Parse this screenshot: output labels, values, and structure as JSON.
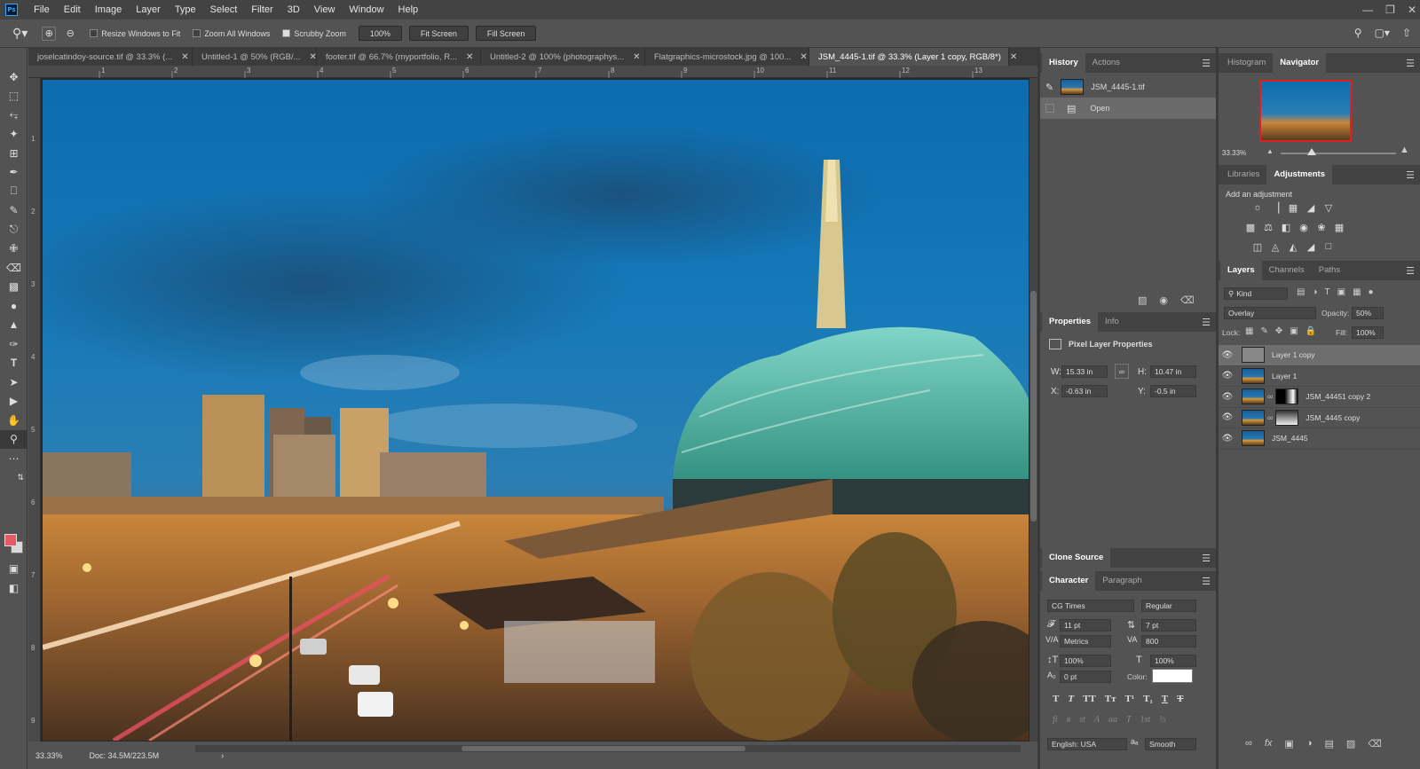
{
  "app": {
    "logo": "Ps"
  },
  "menu": [
    "File",
    "Edit",
    "Image",
    "Layer",
    "Type",
    "Select",
    "Filter",
    "3D",
    "View",
    "Window",
    "Help"
  ],
  "window_controls": {
    "minimize": "—",
    "restore": "❐",
    "close": "✕"
  },
  "options_bar": {
    "resize_windows": "Resize Windows to Fit",
    "zoom_all": "Zoom All Windows",
    "scrubby_zoom": "Scrubby Zoom",
    "zoom_value": "100%",
    "fit_screen": "Fit Screen",
    "fill_screen": "Fill Screen"
  },
  "doc_tabs": [
    "joselcatindoy-source.tif @ 33.3% (...",
    "Untitled-1 @ 50% (RGB/...",
    "footer.tif @ 66.7% (myportfolio, R...",
    "Untitled-2 @ 100% (photographys...",
    "Flatgraphics-microstock.jpg @ 100...",
    "JSM_4445-1.tif @ 33.3% (Layer 1 copy, RGB/8*)"
  ],
  "ruler_marks": [
    "1",
    "2",
    "3",
    "4",
    "5",
    "6",
    "7",
    "8",
    "9",
    "10",
    "11",
    "12",
    "13"
  ],
  "ruler_left_marks": [
    "1",
    "2",
    "3",
    "4",
    "5",
    "6",
    "7",
    "8",
    "9"
  ],
  "status": {
    "zoom": "33.33%",
    "doc": "Doc: 34.5M/223.5M"
  },
  "history": {
    "tabs": [
      "History",
      "Actions"
    ],
    "snapshot": "JSM_4445-1.tif",
    "step": "Open"
  },
  "navigator": {
    "tabs": [
      "Histogram",
      "Navigator"
    ],
    "zoom": "33.33%"
  },
  "adjustments": {
    "tabs": [
      "Libraries",
      "Adjustments"
    ],
    "title": "Add an adjustment"
  },
  "properties": {
    "tabs": [
      "Properties",
      "Info"
    ],
    "title": "Pixel Layer Properties",
    "w_label": "W:",
    "w": "15.33 in",
    "h_label": "H:",
    "h": "10.47 in",
    "x_label": "X:",
    "x": "-0.63 in",
    "y_label": "Y:",
    "y": "-0.5 in"
  },
  "clone_source": {
    "title": "Clone Source"
  },
  "character": {
    "tabs": [
      "Character",
      "Paragraph"
    ],
    "font": "CG Times",
    "style": "Regular",
    "size": "11 pt",
    "leading": "7 pt",
    "kerning": "Metrics",
    "tracking": "800",
    "vscale": "100%",
    "hscale": "100%",
    "baseline": "0 pt",
    "color_label": "Color:",
    "language": "English: USA",
    "antialias": "Smooth"
  },
  "layers": {
    "tabs": [
      "Layers",
      "Channels",
      "Paths"
    ],
    "kind": "Kind",
    "blend": "Overlay",
    "opacity_label": "Opacity:",
    "opacity": "50%",
    "lock_label": "Lock:",
    "fill_label": "Fill:",
    "fill": "100%",
    "items": [
      {
        "name": "Layer 1 copy",
        "thumb": "grey",
        "mask": "",
        "selected": true
      },
      {
        "name": "Layer 1",
        "thumb": "photo",
        "mask": "",
        "selected": false
      },
      {
        "name": "JSM_44451 copy 2",
        "thumb": "photo",
        "mask": "dark",
        "selected": false
      },
      {
        "name": "JSM_4445 copy",
        "thumb": "photo",
        "mask": "light",
        "selected": false
      },
      {
        "name": "JSM_4445",
        "thumb": "photo",
        "mask": "",
        "selected": false
      }
    ]
  },
  "colors": {
    "foreground": "#e25b66",
    "background": "#d9d9d9"
  }
}
